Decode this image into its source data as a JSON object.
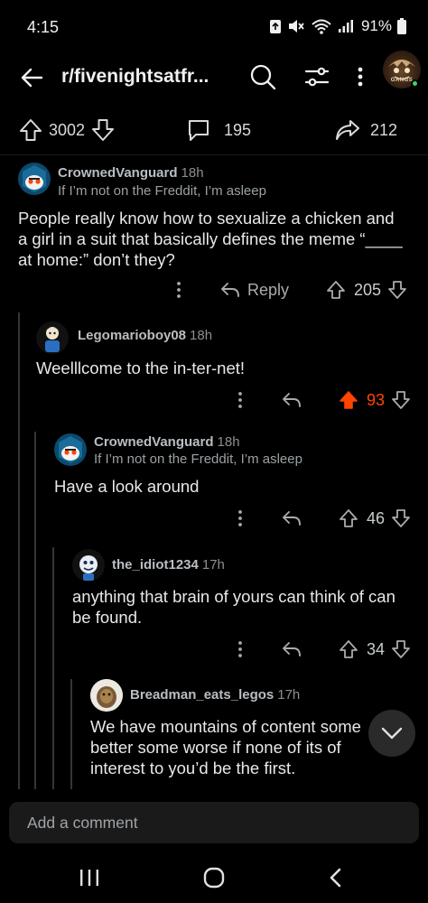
{
  "status_bar": {
    "time": "4:15",
    "battery": "91%"
  },
  "header": {
    "subreddit": "r/fivenightsatfr...",
    "avatar_label": "GANGS"
  },
  "post_stats": {
    "upvotes": "3002",
    "comments": "195",
    "shares": "212"
  },
  "comments": [
    {
      "username": "CrownedVanguard",
      "age": "18h",
      "flair": "If I’m not on the Freddit, I’m asleep",
      "body_lines": [
        "People really know how to sexualize a chicken and",
        "a girl in a suit that basically defines the meme “____",
        "at home:” don’t they?"
      ],
      "reply_label": "Reply",
      "score": "205"
    },
    {
      "username": "Legomarioboy08",
      "age": "18h",
      "body_lines": [
        "Weelllcome to the in-ter-net!"
      ],
      "score": "93",
      "upvoted": true
    },
    {
      "username": "CrownedVanguard",
      "age": "18h",
      "flair": "If I’m not on the Freddit, I’m asleep",
      "body_lines": [
        "Have a look around"
      ],
      "score": "46"
    },
    {
      "username": "the_idiot1234",
      "age": "17h",
      "body_lines": [
        "anything that brain of yours can think of can",
        "be found."
      ],
      "score": "34"
    },
    {
      "username": "Breadman_eats_legos",
      "age": "17h",
      "body_lines": [
        "We have mountains of content some",
        "better some worse if none of its of",
        "interest to you’d be the first."
      ]
    }
  ],
  "composer": {
    "placeholder": "Add a comment"
  },
  "colors": {
    "upvote_active": "#ff4500",
    "background": "#000000",
    "thread_line": "#343536",
    "online": "#46d160"
  }
}
